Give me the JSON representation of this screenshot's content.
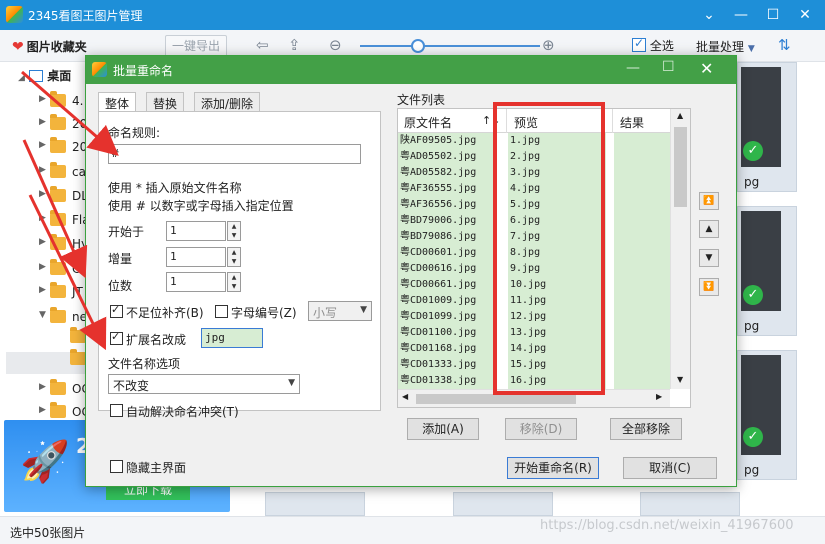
{
  "app": {
    "title": "2345看图王图片管理",
    "win_controls": [
      "⌄",
      "—",
      "☐",
      "✕"
    ]
  },
  "toolbar": {
    "favorites": "图片收藏夹",
    "export": "一键导出",
    "select_all": "全选",
    "batch": "批量处理"
  },
  "tree": {
    "desktop": "桌面",
    "items": [
      "4.",
      "20",
      "20",
      "ca",
      "DL",
      "Fla",
      "Hy",
      "CE",
      "JT",
      "new",
      "",
      "",
      "OC",
      "OC"
    ]
  },
  "thumbs": {
    "jpg_label": "pg"
  },
  "promo": {
    "number": "2",
    "button": "立即下载"
  },
  "statusbar": {
    "text": "选中50张图片",
    "watermark": "https://blog.csdn.net/weixin_41967600"
  },
  "dialog": {
    "title": "批量重命名",
    "tabs": [
      "整体",
      "替换",
      "添加/删除"
    ],
    "rule_label": "命名规则:",
    "rule_value": "#",
    "hint1": "使用 * 插入原始文件名称",
    "hint2": "使用 # 以数字或字母插入指定位置",
    "start_label": "开始于",
    "start_value": "1",
    "step_label": "增量",
    "step_value": "1",
    "digits_label": "位数",
    "digits_value": "1",
    "pad_label": "不足位补齐(B)",
    "pad_checked": true,
    "letter_label": "字母编号(Z)",
    "letter_checked": false,
    "case_value": "小写",
    "ext_label": "扩展名改成",
    "ext_checked": true,
    "ext_value": "jpg",
    "name_opt_label": "文件名称选项",
    "name_opt_value": "不改变",
    "auto_resolve_label": "自动解决命名冲突(T)",
    "auto_resolve_checked": false,
    "hide_main_label": "隐藏主界面",
    "hide_main_checked": false,
    "list_title": "文件列表",
    "columns": [
      "原文件名",
      "预览",
      "结果"
    ],
    "sort_icons": "↑↓",
    "rows": [
      {
        "orig": "陕AF09505.jpg",
        "preview": "1.jpg",
        "result": ""
      },
      {
        "orig": "粤AD05502.jpg",
        "preview": "2.jpg",
        "result": ""
      },
      {
        "orig": "粤AD05582.jpg",
        "preview": "3.jpg",
        "result": ""
      },
      {
        "orig": "粤AF36555.jpg",
        "preview": "4.jpg",
        "result": ""
      },
      {
        "orig": "粤AF36556.jpg",
        "preview": "5.jpg",
        "result": ""
      },
      {
        "orig": "粤BD79006.jpg",
        "preview": "6.jpg",
        "result": ""
      },
      {
        "orig": "粤BD79086.jpg",
        "preview": "7.jpg",
        "result": ""
      },
      {
        "orig": "粤CD00601.jpg",
        "preview": "8.jpg",
        "result": ""
      },
      {
        "orig": "粤CD00616.jpg",
        "preview": "9.jpg",
        "result": ""
      },
      {
        "orig": "粤CD00661.jpg",
        "preview": "10.jpg",
        "result": ""
      },
      {
        "orig": "粤CD01009.jpg",
        "preview": "11.jpg",
        "result": ""
      },
      {
        "orig": "粤CD01099.jpg",
        "preview": "12.jpg",
        "result": ""
      },
      {
        "orig": "粤CD01100.jpg",
        "preview": "13.jpg",
        "result": ""
      },
      {
        "orig": "粤CD01168.jpg",
        "preview": "14.jpg",
        "result": ""
      },
      {
        "orig": "粤CD01333.jpg",
        "preview": "15.jpg",
        "result": ""
      },
      {
        "orig": "粤CD01338.jpg",
        "preview": "16.jpg",
        "result": ""
      }
    ],
    "add_button": "添加(A)",
    "remove_button": "移除(D)",
    "remove_all_button": "全部移除",
    "start_button": "开始重命名(R)",
    "cancel_button": "取消(C)"
  },
  "colors": {
    "main_title": "#1e8fd8",
    "dialog_title": "#43a047",
    "row_green": "#d7edd3",
    "highlight_red": "#e5322d"
  }
}
